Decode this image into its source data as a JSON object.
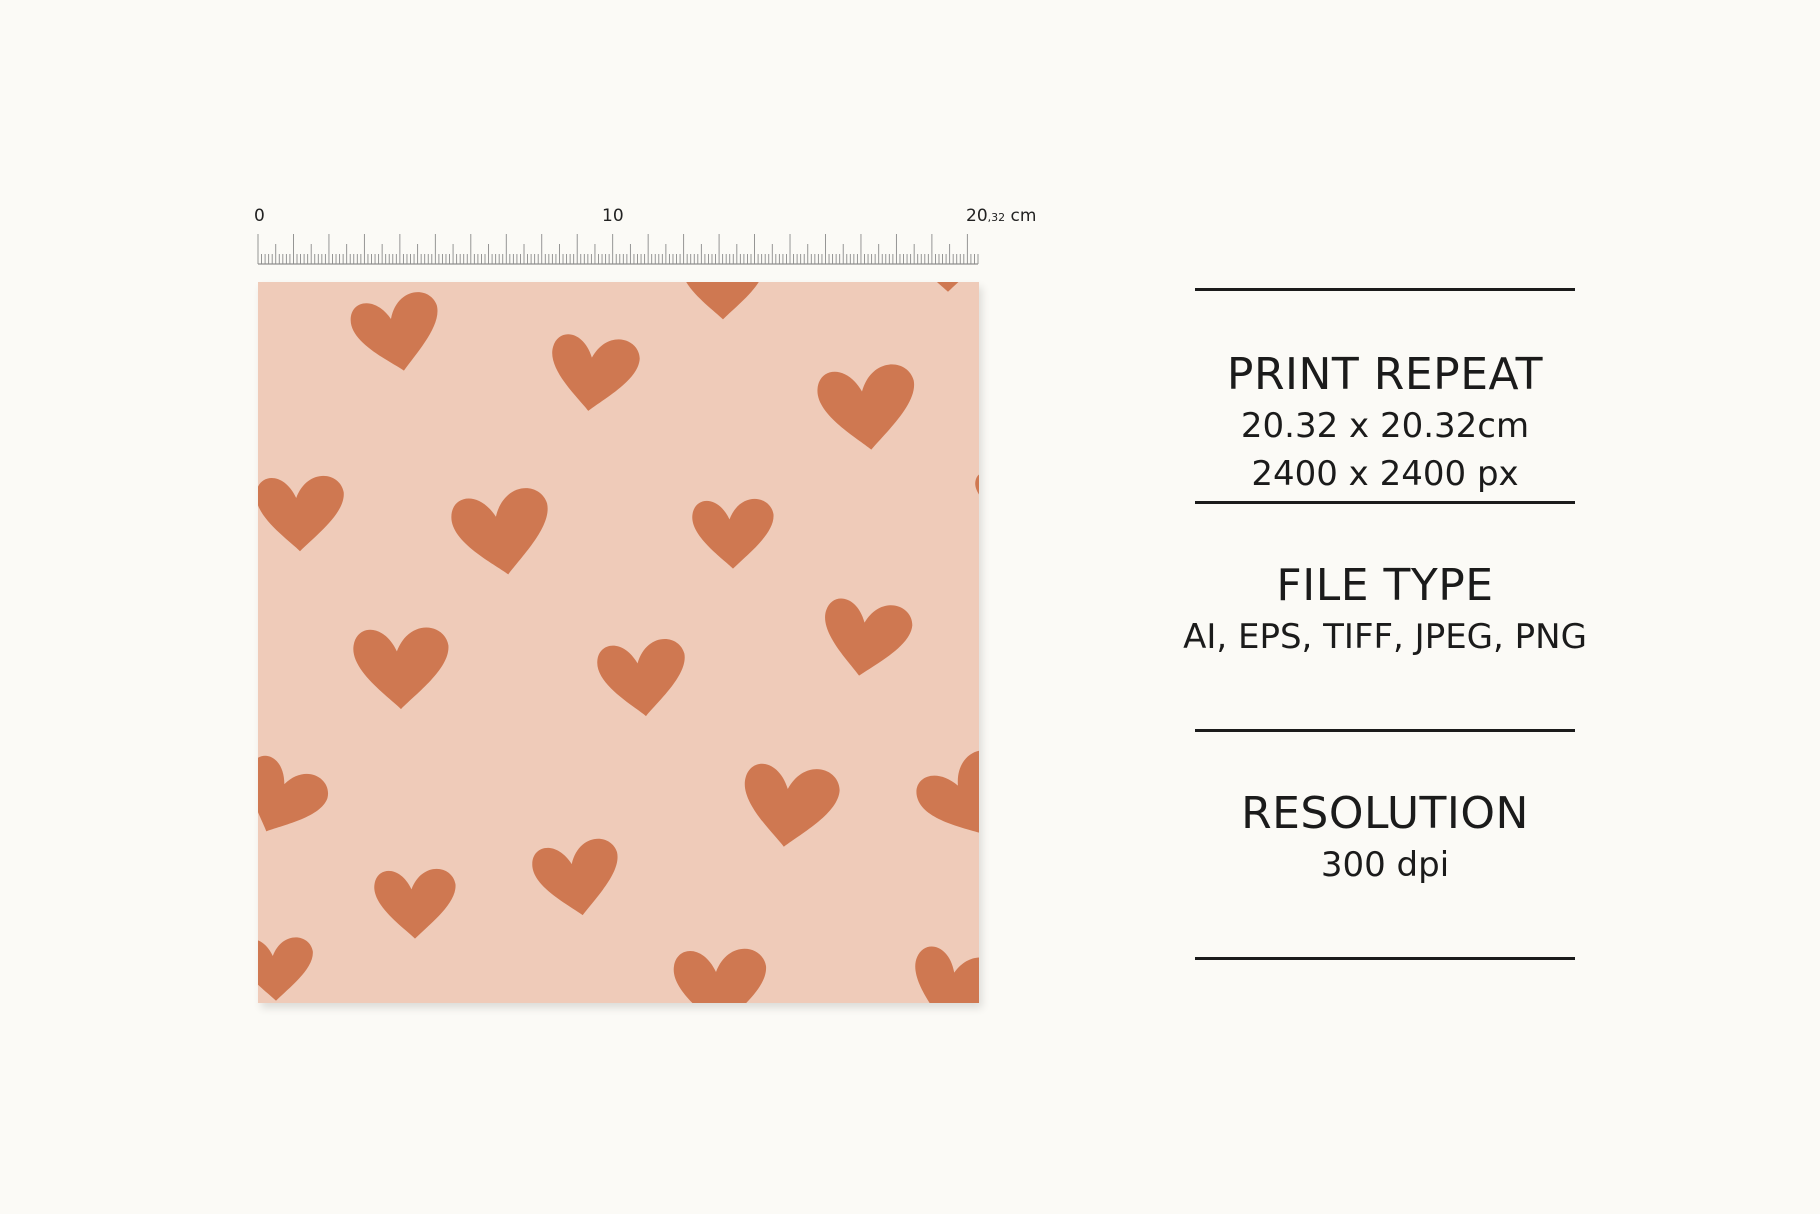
{
  "ruler": {
    "label_start": "0",
    "label_mid": "10",
    "label_end_main": "20",
    "label_end_sub": ",32",
    "label_end_unit": " cm"
  },
  "pattern": {
    "background_color": "#efcbb9",
    "heart_color": "#cf7851",
    "motif_icon": "heart-icon"
  },
  "info": {
    "print_repeat": {
      "title": "PRINT REPEAT",
      "line1": "20.32 x 20.32cm",
      "line2": "2400 x 2400 px"
    },
    "file_type": {
      "title": "FILE TYPE",
      "line1": "AI, EPS, TIFF, JPEG, PNG"
    },
    "resolution": {
      "title": "RESOLUTION",
      "line1": "300 dpi"
    }
  },
  "colors": {
    "page_background": "#fbfaf6",
    "text": "#1b1b1b",
    "rule": "#1b1b1b"
  }
}
